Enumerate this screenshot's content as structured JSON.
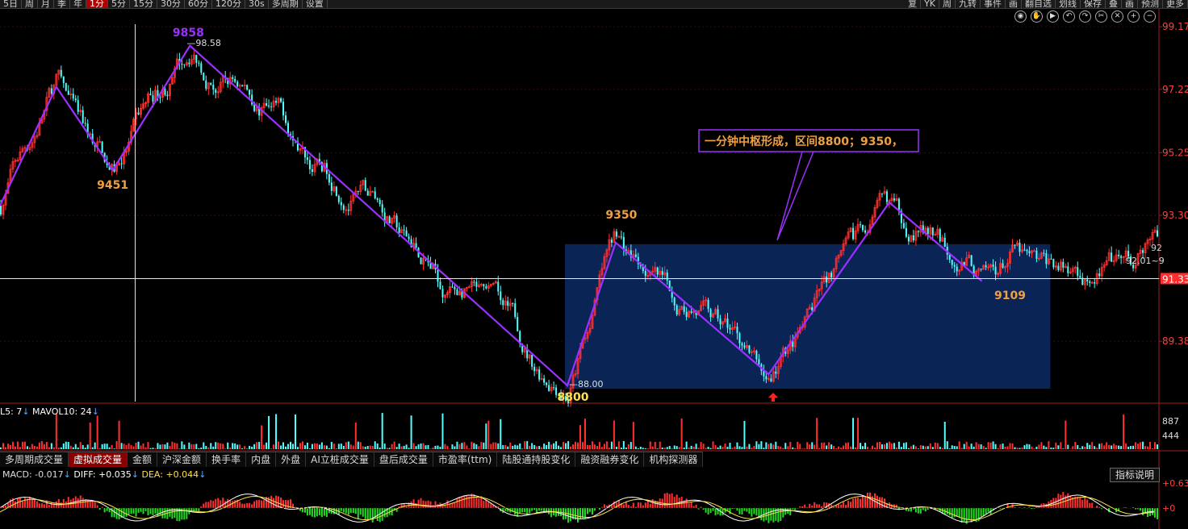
{
  "topbar": {
    "left_tabs": [
      "5日",
      "周",
      "月",
      "季",
      "年",
      "1分",
      "5分",
      "15分",
      "30分",
      "60分",
      "120分",
      "30s",
      "多周期",
      "设置"
    ],
    "active_tab": "1分",
    "right_tabs": [
      "复",
      "YK",
      "周",
      "九转",
      "事件",
      "画",
      "翻自选",
      "划线",
      "保存",
      "叠",
      "画",
      "预测",
      "更多"
    ]
  },
  "toolbar_icons": [
    "eye-icon",
    "hand-icon",
    "play-icon",
    "undo-icon",
    "redo-icon",
    "scissors-icon",
    "close-icon",
    "zoom-in-icon",
    "zoom-out-icon"
  ],
  "price_axis": {
    "ticks": [
      "99.17",
      "97.22",
      "95.25",
      "93.30",
      "91.33",
      "89.38"
    ],
    "current_price": "91.33",
    "right_price_label": "92",
    "range_label": "92.01~9"
  },
  "annotations": {
    "peak1": "9858",
    "peak1_price": "98.58",
    "low1": "9451",
    "peak2": "9350",
    "low2": "8800",
    "low2_price": "88.00",
    "low3": "9109",
    "callout": "一分钟中枢形成，区间8800；9350，"
  },
  "volume": {
    "legend_prefix": "L5: 7",
    "legend_ma10": "MAVOL10: 24",
    "axis_ticks": [
      "887",
      "444"
    ]
  },
  "bottom_tabs": [
    "多周期成交量",
    "虚拟成交量",
    "金额",
    "沪深金额",
    "换手率",
    "内盘",
    "外盘",
    "AI立桩成交量",
    "盘后成交量",
    "市盈率(ttm)",
    "陆股通持股变化",
    "融资融券变化",
    "机构探测器"
  ],
  "active_bottom_tab": "虚拟成交量",
  "macd": {
    "label_macd": "MACD: -0.017",
    "label_diff": "DIFF: +0.035",
    "label_dea": "DEA: +0.044",
    "axis_top": "+0.63",
    "axis_zero": "+0",
    "explain_button": "指标说明"
  },
  "colors": {
    "up": "#ff3030",
    "down": "#54ffff",
    "zigzag": "#9b30ff",
    "zone": "#0b2456",
    "axis_text": "#ff4040",
    "label_orange": "#f0a040",
    "price_highlight": "#ff2d2d"
  },
  "chart_data": {
    "type": "candlestick",
    "title": "",
    "ylim": [
      87.5,
      99.3
    ],
    "y_ticks": [
      99.17,
      97.22,
      95.25,
      93.3,
      91.33,
      89.38
    ],
    "zigzag": [
      {
        "i": 0,
        "price": 93.6
      },
      {
        "i": 70,
        "price": 97.3
      },
      {
        "i": 140,
        "price": 94.7
      },
      {
        "i": 236,
        "price": 98.58
      },
      {
        "i": 705,
        "price": 88.0
      },
      {
        "i": 765,
        "price": 92.45
      },
      {
        "i": 955,
        "price": 88.35
      },
      {
        "i": 1105,
        "price": 93.7
      },
      {
        "i": 1220,
        "price": 91.25
      },
      {
        "i": 1260,
        "price": 92.2
      },
      {
        "i": 1325,
        "price": 91.3
      },
      {
        "i": 1430,
        "price": 92.3
      }
    ],
    "zone": {
      "i_start": 702,
      "i_end": 1305,
      "price_low": 87.9,
      "price_high": 92.4
    },
    "crosshair_price": 91.33
  }
}
